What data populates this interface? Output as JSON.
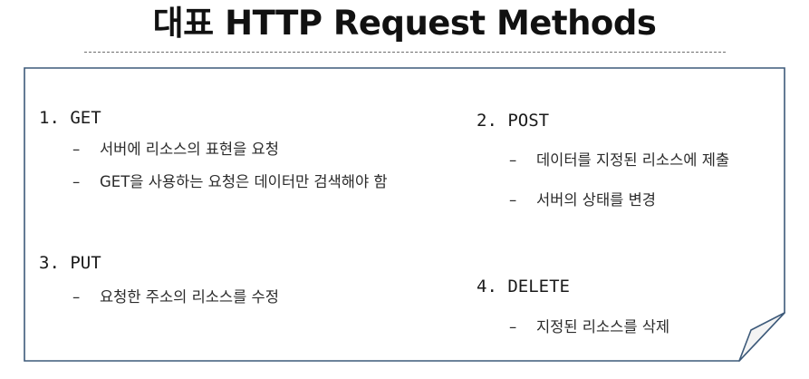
{
  "title": "대표 HTTP Request Methods",
  "methods": [
    {
      "heading": "1. GET",
      "bullet_marker": "–",
      "bullets": [
        "서버에 리소스의 표현을 요청",
        "GET을 사용하는 요청은 데이터만 검색해야 함"
      ]
    },
    {
      "heading": "2. POST",
      "bullet_marker": "–",
      "bullets": [
        "데이터를 지정된 리소스에 제출",
        "서버의 상태를 변경"
      ]
    },
    {
      "heading": "3. PUT",
      "bullet_marker": "–",
      "bullets": [
        "요청한 주소의 리소스를 수정"
      ]
    },
    {
      "heading": "4. DELETE",
      "bullet_marker": "–",
      "bullets": [
        "지정된 리소스를 삭제"
      ]
    }
  ],
  "colors": {
    "note_border": "#3d5a7a",
    "fold_fill": "#f4f4f4",
    "title_rule": "#6e6e6e"
  }
}
